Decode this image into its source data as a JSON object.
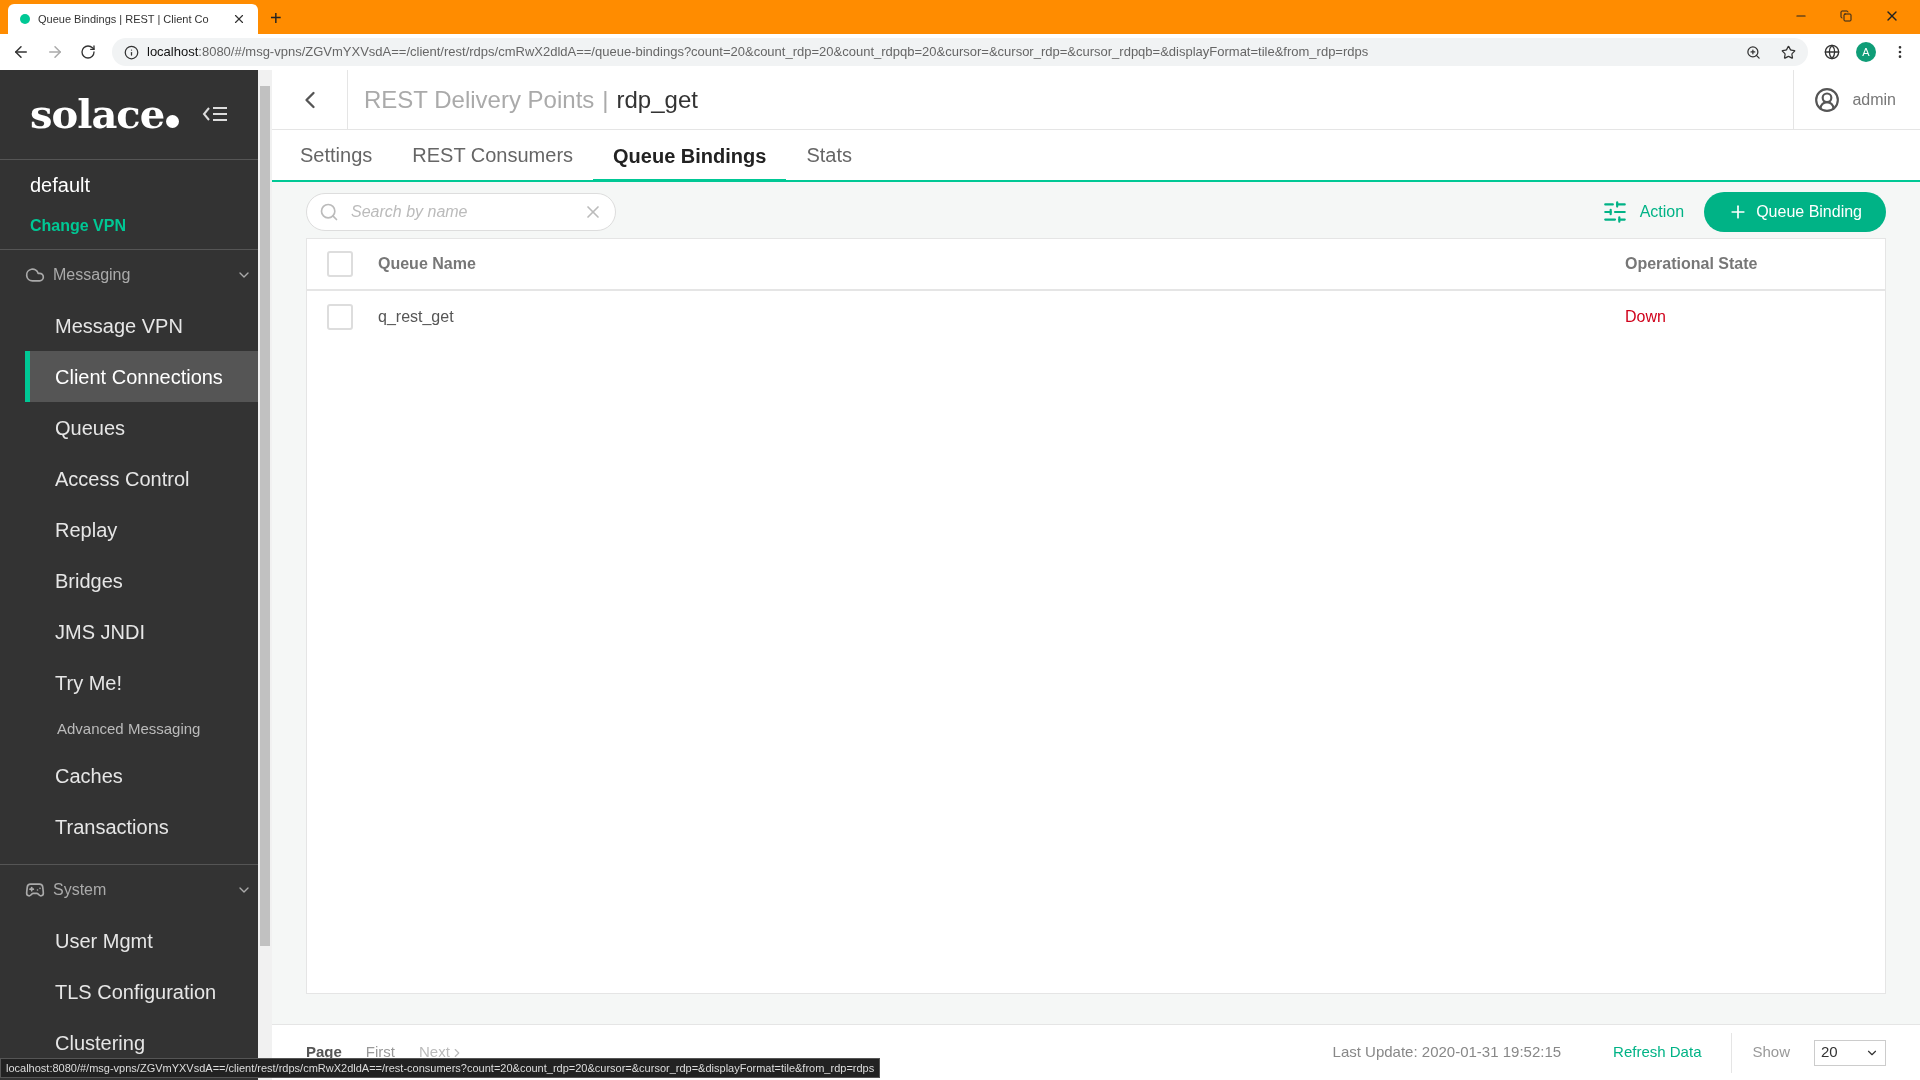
{
  "browser": {
    "tab_title": "Queue Bindings | REST | Client Co",
    "new_tab": "+",
    "url_host": "localhost",
    "url_rest": ":8080/#/msg-vpns/ZGVmYXVsdA==/client/rest/rdps/cmRwX2dldA==/queue-bindings?count=20&count_rdp=20&count_rdpqb=20&cursor=&cursor_rdp=&cursor_rdpqb=&displayFormat=tile&from_rdp=rdps",
    "profile": "A"
  },
  "sidebar": {
    "logo": "solace",
    "vpn": "default",
    "change_vpn": "Change VPN",
    "sections": [
      {
        "title": "Messaging",
        "expanded": true,
        "items": [
          {
            "label": "Message VPN",
            "kind": "item",
            "selected": false
          },
          {
            "label": "Client Connections",
            "kind": "item",
            "selected": true
          },
          {
            "label": "Queues",
            "kind": "item",
            "selected": false
          },
          {
            "label": "Access Control",
            "kind": "item",
            "selected": false
          },
          {
            "label": "Replay",
            "kind": "item",
            "selected": false
          },
          {
            "label": "Bridges",
            "kind": "item",
            "selected": false
          },
          {
            "label": "JMS JNDI",
            "kind": "item",
            "selected": false
          },
          {
            "label": "Try Me!",
            "kind": "item",
            "selected": false
          },
          {
            "label": "Advanced Messaging",
            "kind": "subheading"
          },
          {
            "label": "Caches",
            "kind": "item",
            "selected": false
          },
          {
            "label": "Transactions",
            "kind": "item",
            "selected": false
          }
        ]
      },
      {
        "title": "System",
        "expanded": true,
        "items": [
          {
            "label": "User Mgmt",
            "kind": "item",
            "selected": false
          },
          {
            "label": "TLS Configuration",
            "kind": "item",
            "selected": false
          },
          {
            "label": "Clustering",
            "kind": "item",
            "selected": false
          }
        ]
      }
    ]
  },
  "header": {
    "breadcrumb": "REST Delivery Points",
    "separator": "|",
    "title": "rdp_get",
    "user": "admin"
  },
  "tabs": [
    {
      "label": "Settings",
      "selected": false
    },
    {
      "label": "REST Consumers",
      "selected": false
    },
    {
      "label": "Queue Bindings",
      "selected": true
    },
    {
      "label": "Stats",
      "selected": false
    }
  ],
  "toolbar": {
    "search_placeholder": "Search by name",
    "action": "Action",
    "add_button": "Queue Binding"
  },
  "table": {
    "columns": [
      "Queue Name",
      "Operational State"
    ],
    "all_checked": false,
    "rows": [
      {
        "name": "q_rest_get",
        "state": "Down",
        "checked": false,
        "color": "#d0021b"
      }
    ]
  },
  "footer": {
    "page": "Page",
    "first": "First",
    "next": "Next",
    "last_update": "Last Update: 2020-01-31 19:52:15",
    "refresh": "Refresh Data",
    "show": "Show",
    "page_size": "20"
  },
  "status_url": "localhost:8080/#/msg-vpns/ZGVmYXVsdA==/client/rest/rdps/cmRwX2dldA==/rest-consumers?count=20&count_rdp=20&cursor=&cursor_rdp=&displayFormat=tile&from_rdp=rdps"
}
